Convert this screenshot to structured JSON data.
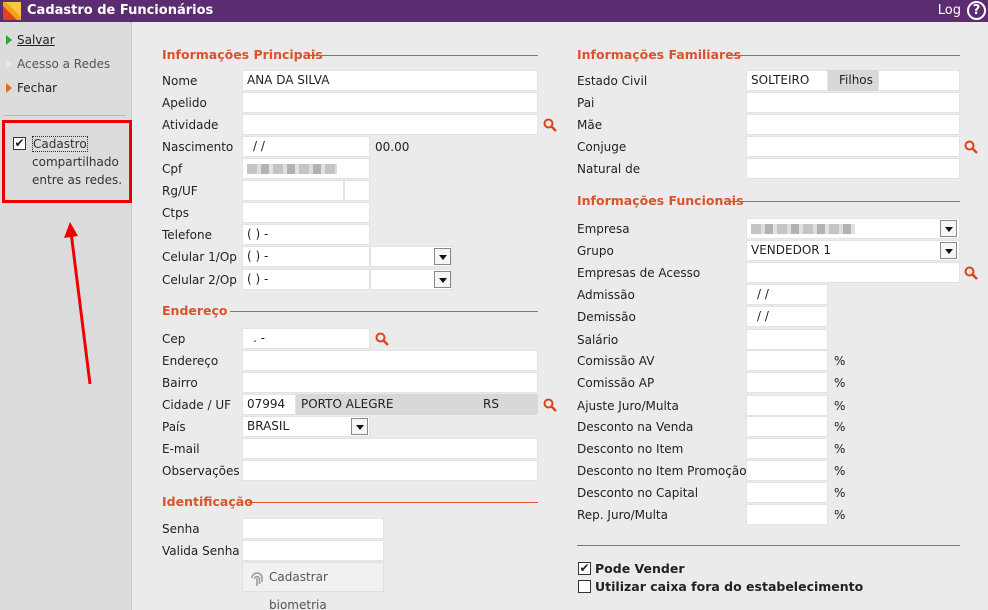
{
  "window": {
    "title": "Cadastro de Funcionários",
    "log_label": "Log",
    "help_label": "?"
  },
  "sidebar": {
    "save_label": "Salvar",
    "network_access_label": "Acesso a Redes",
    "close_label": "Fechar",
    "shared_checkbox": {
      "checked": true,
      "check_mark": "✔",
      "label_first": "Cadastro",
      "label_rest": "compartilhado entre as redes."
    }
  },
  "main_info": {
    "section_title": "Informações Principais",
    "nome_label": "Nome",
    "nome_value": "ANA DA SILVA",
    "apelido_label": "Apelido",
    "apelido_value": "",
    "atividade_label": "Atividade",
    "atividade_value": "",
    "nascimento_label": "Nascimento",
    "nascimento_value": "/ /",
    "nascimento_extra": "00.00",
    "cpf_label": "Cpf",
    "rg_label": "Rg/UF",
    "ctps_label": "Ctps",
    "telefone_label": "Telefone",
    "telefone_value": "(  )   -",
    "celular1_label": "Celular 1/Op",
    "celular1_value": "(  )   -",
    "celular2_label": "Celular 2/Op",
    "celular2_value": "(  )   -"
  },
  "address": {
    "section_title": "Endereço",
    "cep_label": "Cep",
    "cep_value": ".  -",
    "endereco_label": "Endereço",
    "endereco_value": "",
    "bairro_label": "Bairro",
    "bairro_value": "",
    "cidade_label": "Cidade / UF",
    "cidade_code": "07994",
    "cidade_name": "PORTO ALEGRE",
    "uf": "RS",
    "pais_label": "País",
    "pais_value": "BRASIL",
    "email_label": "E-mail",
    "email_value": "",
    "obs_label": "Observações",
    "obs_value": ""
  },
  "identification": {
    "section_title": "Identificação",
    "senha_label": "Senha",
    "valida_senha_label": "Valida Senha",
    "biometria_label": "Cadastrar biometria"
  },
  "family": {
    "section_title": "Informações Familiares",
    "estado_civil_label": "Estado Civil",
    "estado_civil_value": "SOLTEIRO",
    "filhos_label": "Filhos",
    "filhos_value": "",
    "pai_label": "Pai",
    "mae_label": "Mãe",
    "conjuge_label": "Conjuge",
    "natural_label": "Natural de"
  },
  "job": {
    "section_title": "Informações Funcionais",
    "empresa_label": "Empresa",
    "grupo_label": "Grupo",
    "grupo_value": "VENDEDOR 1",
    "empresas_acesso_label": "Empresas de Acesso",
    "admissao_label": "Admissão",
    "admissao_value": "/ /",
    "demissao_label": "Demissão",
    "demissao_value": "/ /",
    "salario_label": "Salário",
    "comissao_av_label": "Comissão AV",
    "comissao_ap_label": "Comissão AP",
    "ajuste_label": "Ajuste Juro/Multa",
    "desc_venda_label": "Desconto na Venda",
    "desc_item_label": "Desconto no Item",
    "desc_item_promo_label": "Desconto no Item Promoção",
    "desc_capital_label": "Desconto no Capital",
    "rep_juro_label": "Rep. Juro/Multa",
    "percent_sign": "%"
  },
  "options": {
    "pode_vender_label": "Pode Vender",
    "pode_vender_checked": true,
    "caixa_fora_label": "Utilizar caixa fora do estabelecimento",
    "caixa_fora_checked": false,
    "check_mark": "✔"
  },
  "colors": {
    "titlebar": "#5b2c6f",
    "section": "#d9542b",
    "annotation": "#e00000"
  }
}
